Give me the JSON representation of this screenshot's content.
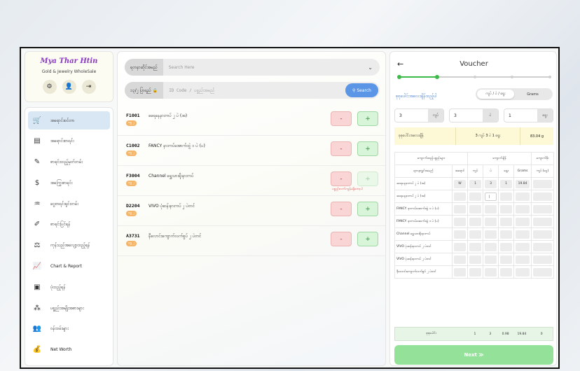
{
  "sidebar": {
    "brand_title": "Mya Thar Htin",
    "brand_subtitle": "Gold & Jewelry WholeSale",
    "actions": [
      {
        "icon": "gear-icon",
        "glyph": "⚙"
      },
      {
        "icon": "user-icon",
        "glyph": "👤"
      },
      {
        "icon": "logout-icon",
        "glyph": "⇥"
      }
    ],
    "items": [
      {
        "label": "အရောင်းစင်တာ",
        "icon": "cart-icon",
        "glyph": "🛒",
        "active": true
      },
      {
        "label": "အရောင်းစာရင်း",
        "icon": "list-icon",
        "glyph": "▤"
      },
      {
        "label": "စာရင်းထည့်မှတ်တမ်း",
        "icon": "edit-list-icon",
        "glyph": "✎"
      },
      {
        "label": "အကြွေးစာရင်း",
        "icon": "debt-icon",
        "glyph": "$"
      },
      {
        "label": "ငွေစာရင်းရှင်းတမ်း",
        "icon": "cash-hand-icon",
        "glyph": "♒"
      },
      {
        "label": "စာရင်းပြင်ရန်",
        "icon": "pencil-square-icon",
        "glyph": "✐"
      },
      {
        "label": "ကုန်သည်အလျော့ထည့်ရန်",
        "icon": "scale-icon",
        "glyph": "⚖"
      },
      {
        "label": "Chart & Report",
        "icon": "chart-icon",
        "glyph": "📈"
      },
      {
        "label": "ပုံထည့်ရန်",
        "icon": "image-icon",
        "glyph": "▣"
      },
      {
        "label": "ပစ္စည်းအမျိုးအစားများ",
        "icon": "category-icon",
        "glyph": "⁂"
      },
      {
        "label": "ဝန်ထမ်းများ",
        "icon": "staff-icon",
        "glyph": "👥"
      },
      {
        "label": "Net Worth",
        "icon": "moneybag-icon",
        "glyph": "💰"
      }
    ]
  },
  "search": {
    "category_label": "ရတနာဆိုင်အမည်",
    "category_placeholder": "Search Here",
    "code_label": "၁၃/၂ ပြာရည်",
    "code_placeholder": "ID Code / ပစ္စည်းအမည်",
    "search_button": "Search"
  },
  "products": [
    {
      "code": "F1001",
      "name": "ခရေနေနားကပ် ၂ ပဲ (အ)",
      "badge": "ရွှေ ၂",
      "plus_disabled": false,
      "warning": ""
    },
    {
      "code": "C1002",
      "name": "FANCY နားကပ်အောက်ထွဲ ၁ ပဲ (ပ)",
      "badge": "ရွှေ ၂",
      "plus_disabled": false,
      "warning": ""
    },
    {
      "code": "F3004",
      "name": "Channel ရွှေသားရိုးနားကပ်",
      "badge": "ရွှေ ၂",
      "plus_disabled": true,
      "warning": "ပစ္စည်းလက်ကျန်မရှိတော့ပါ"
    },
    {
      "code": "D2204",
      "name": "VIVO ပုံဆန်းနားကပ် ၂ ပဲတင်",
      "badge": "ရွှေ ၂",
      "plus_disabled": false,
      "warning": ""
    },
    {
      "code": "A3731",
      "name": "နီလောင်းကျောက်လက်စွပ် ၂ ပဲတင်",
      "badge": "ရွှေ ၂",
      "plus_disabled": false,
      "warning": ""
    }
  ],
  "quantity_buttons": {
    "minus": "-",
    "plus": "+"
  },
  "voucher": {
    "title": "Voucher",
    "back_glyph": "←",
    "steps_total": 5,
    "steps_done": 2,
    "section_label": "စုစုပေါင်းအလေးချိန်ထည့်ပါ",
    "toggle_options": [
      "ကျပ် / ပဲ / ရွေး",
      "Grams"
    ],
    "toggle_selected": 0,
    "inputs": [
      {
        "value": "3",
        "unit": "ကျပ်"
      },
      {
        "value": "3",
        "unit": "ပဲ"
      },
      {
        "value": "1",
        "unit": "ရွေး"
      }
    ],
    "summary": {
      "label": "စုစုပေါင်းအလေးချိန်",
      "value": "3 ကျပ် 3 ပဲ 1 ရွေး",
      "grams": "83.04 g"
    },
    "table": {
      "group_headers": [
        "ကျောက်ထည့်ပစ္စည်းများ",
        "ကျောက်ချိန်",
        "ကျောက်ဖိုး"
      ],
      "columns": [
        "ရတနာရွှင်းအမည်",
        "အရောင်",
        "ကျပ်",
        "ပဲ",
        "ရွေး",
        "Grams",
        "ကျပ် (ငွေ)"
      ],
      "rows": [
        {
          "name": "ခရေနေနားကပ် ၂ ပဲ (အ)",
          "color": "W",
          "kyat": "1",
          "pe": "3",
          "yway": "1",
          "grams": "19.84",
          "price": ""
        },
        {
          "name": "ခရေနေနားကပ် ၂ ပဲ (အ)",
          "color": "",
          "kyat": "",
          "pe": "|",
          "yway": "",
          "grams": "",
          "price": ""
        },
        {
          "name": "FANCY နားကပ်အောက်ထွဲ ၁ ပဲ (ပ)",
          "color": "",
          "kyat": "",
          "pe": "",
          "yway": "",
          "grams": "",
          "price": ""
        },
        {
          "name": "FANCY နားကပ်အောက်ထွဲ ၁ ပဲ (ပ)",
          "color": "",
          "kyat": "",
          "pe": "",
          "yway": "",
          "grams": "",
          "price": ""
        },
        {
          "name": "Channel ရွှေသားရိုးနားကပ်",
          "color": "",
          "kyat": "",
          "pe": "",
          "yway": "",
          "grams": "",
          "price": ""
        },
        {
          "name": "VIVO ပုံဆန်းနားကပ် ၂ ပဲတင်",
          "color": "",
          "kyat": "",
          "pe": "",
          "yway": "",
          "grams": "",
          "price": ""
        },
        {
          "name": "VIVO ပုံဆန်းနားကပ် ၂ ပဲတင်",
          "color": "",
          "kyat": "",
          "pe": "",
          "yway": "",
          "grams": "",
          "price": ""
        },
        {
          "name": "နီလောင်းကျောက်လက်စွပ် ၂ ပဲတင်",
          "color": "",
          "kyat": "",
          "pe": "",
          "yway": "",
          "grams": "",
          "price": ""
        }
      ],
      "total": {
        "label": "စုစုပေါင်း",
        "kyat": "1",
        "pe": "3",
        "yway": "0.98",
        "grams": "19.84",
        "price": "0"
      }
    },
    "next_button": "Next ≫"
  },
  "colors": {
    "accent": "#5b96e6",
    "step_done": "#3dbb4a",
    "step_todo": "#cfcfcf",
    "next": "#94e29a"
  }
}
